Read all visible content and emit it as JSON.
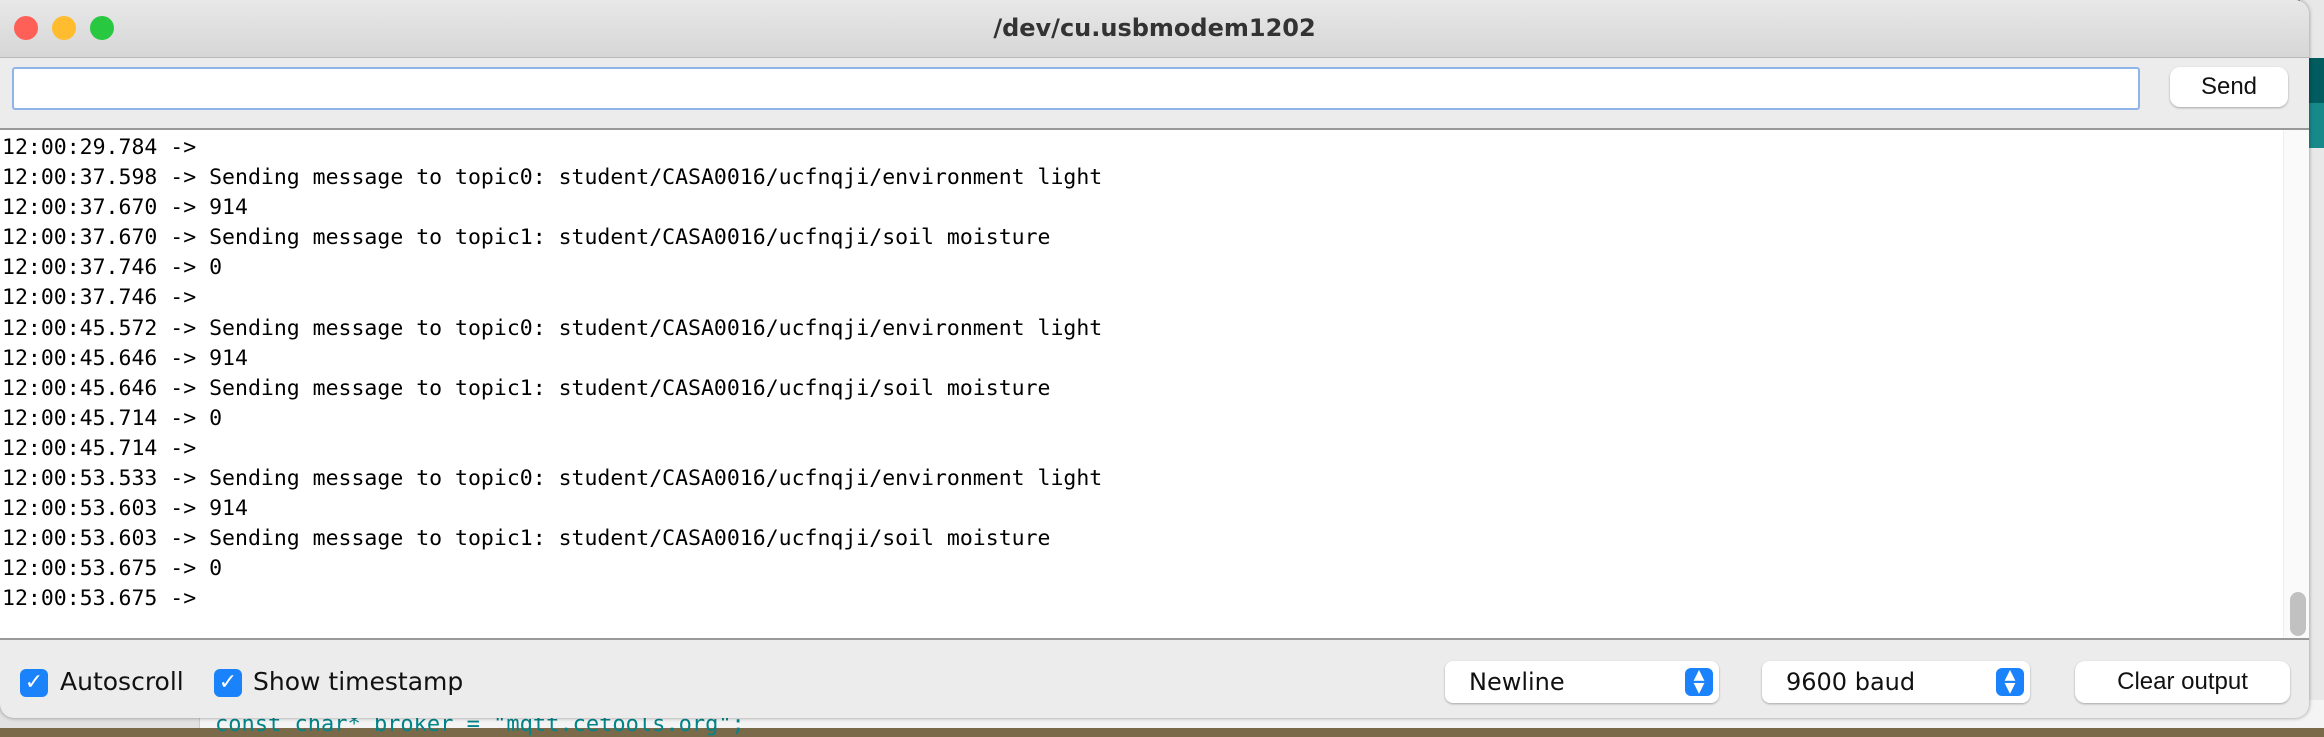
{
  "window": {
    "title": "/dev/cu.usbmodem1202"
  },
  "input": {
    "value": "",
    "send_label": "Send"
  },
  "output": {
    "lines": [
      "12:00:29.784 -> ",
      "12:00:37.598 -> Sending message to topic0: student/CASA0016/ucfnqji/environment light",
      "12:00:37.670 -> 914",
      "12:00:37.670 -> Sending message to topic1: student/CASA0016/ucfnqji/soil moisture",
      "12:00:37.746 -> 0",
      "12:00:37.746 -> ",
      "12:00:45.572 -> Sending message to topic0: student/CASA0016/ucfnqji/environment light",
      "12:00:45.646 -> 914",
      "12:00:45.646 -> Sending message to topic1: student/CASA0016/ucfnqji/soil moisture",
      "12:00:45.714 -> 0",
      "12:00:45.714 -> ",
      "12:00:53.533 -> Sending message to topic0: student/CASA0016/ucfnqji/environment light",
      "12:00:53.603 -> 914",
      "12:00:53.603 -> Sending message to topic1: student/CASA0016/ucfnqji/soil moisture",
      "12:00:53.675 -> 0",
      "12:00:53.675 -> "
    ]
  },
  "footer": {
    "autoscroll_label": "Autoscroll",
    "autoscroll_checked": true,
    "timestamp_label": "Show timestamp",
    "timestamp_checked": true,
    "line_ending": "Newline",
    "baud": "9600 baud",
    "clear_label": "Clear output"
  },
  "background": {
    "code_snippet": "const char* broker = \"mqtt.cetools.org\";"
  }
}
